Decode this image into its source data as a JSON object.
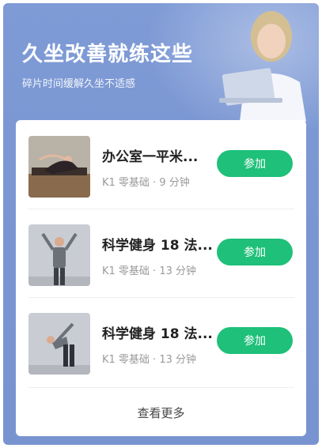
{
  "header": {
    "title": "久坐改善就练这些",
    "subtitle": "碎片时间缓解久坐不适感"
  },
  "items": [
    {
      "title": "办公室一平米...",
      "meta": "K1 零基础 · 9 分钟",
      "button_label": "参加"
    },
    {
      "title": "科学健身 18 法...",
      "meta": "K1 零基础 · 13 分钟",
      "button_label": "参加"
    },
    {
      "title": "科学健身 18 法...",
      "meta": "K1 零基础 · 13 分钟",
      "button_label": "参加"
    }
  ],
  "footer": {
    "more_label": "查看更多"
  },
  "colors": {
    "panel_bg": "#7f9bd6",
    "join_button": "#1ec07a"
  }
}
